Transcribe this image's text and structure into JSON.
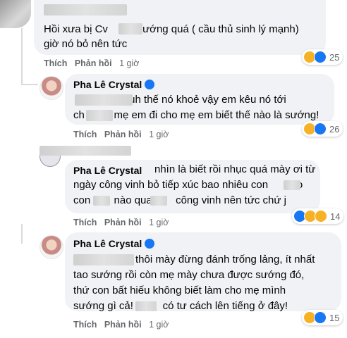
{
  "comments": [
    {
      "text_lines": [
        "Hồi xưa bị Cv          sướng quá ( cầu thủ sinh lý mạnh)",
        "giờ nó bỏ nên tức"
      ],
      "actions": {
        "like": "Thích",
        "reply": "Phản hồi",
        "time": "1 giờ"
      },
      "reactions": {
        "icons": [
          "haha-icon",
          "like-icon"
        ],
        "count": "25"
      }
    },
    {
      "author": "Pha Lê Crystal",
      "text_lines": [
        "                   uh thế nó khoẻ vậy em kêu nó tới",
        "ch          mẹ em đi cho mẹ em biết thế nào là sướng!"
      ],
      "actions": {
        "like": "Thích",
        "reply": "Phản hồi",
        "time": "1 giờ"
      },
      "reactions": {
        "icons": [
          "haha-icon",
          "like-icon"
        ],
        "count": "26"
      }
    },
    {
      "author": "Pha Lê Crystal",
      "text_lines": [
        "nhìn là biết rồi nhục quá mày ơi từ",
        "ngày công vinh bỏ tiếp xúc bao nhiêu con        ko",
        "con        nào qua        công vinh nên tức chứ j"
      ],
      "actions": {
        "like": "Thích",
        "reply": "Phản hồi",
        "time": "1 giờ"
      },
      "reactions": {
        "icons": [
          "like-icon",
          "haha-icon",
          "wow-icon"
        ],
        "count": "14"
      }
    },
    {
      "author": "Pha Lê Crystal",
      "text_lines": [
        "thôi mày đừng đánh trống lảng, ít nhất",
        "tao sướng rồi còn mẹ mày chưa được sướng đó,",
        "thứ con bất hiếu không biết làm cho mẹ mình",
        "sướng gì cả!          có tư cách lên tiếng ở đây!"
      ],
      "actions": {
        "like": "Thích",
        "reply": "Phản hồi",
        "time": "1 giờ"
      },
      "reactions": {
        "icons": [
          "haha-icon",
          "like-icon"
        ],
        "count": "15"
      }
    }
  ],
  "colors": {
    "like": "#1877f2",
    "haha": "#f7b125",
    "bubble": "#f0f2f5",
    "meta": "#65676b"
  }
}
